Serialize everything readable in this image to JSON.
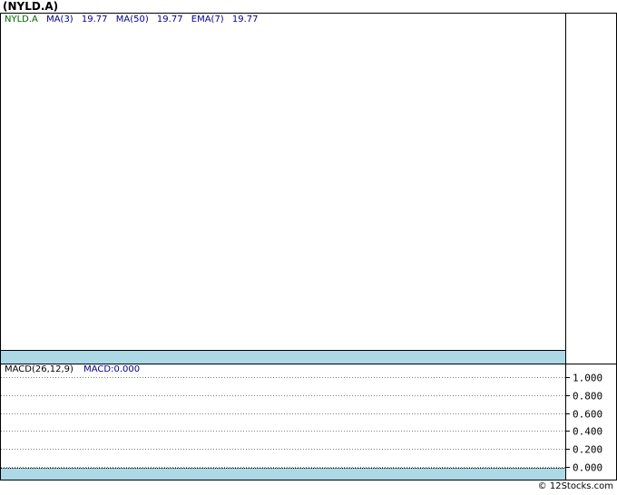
{
  "title": "(NYLD.A)",
  "legend": {
    "symbol": "NYLD.A",
    "ma3_label": "MA(3)",
    "ma3_value": "19.77",
    "ma50_label": "MA(50)",
    "ma50_value": "19.77",
    "ema7_label": "EMA(7)",
    "ema7_value": "19.77"
  },
  "macd_legend": {
    "label": "MACD(26,12,9)",
    "value": "MACD:0.000"
  },
  "footer": "© 12Stocks.com",
  "chart_data": {
    "type": "line",
    "title": "(NYLD.A)",
    "panels": [
      {
        "name": "price",
        "series": [
          {
            "name": "MA(3)",
            "last_value": 19.77
          },
          {
            "name": "MA(50)",
            "last_value": 19.77
          },
          {
            "name": "EMA(7)",
            "last_value": 19.77
          }
        ]
      },
      {
        "name": "MACD(26,12,9)",
        "series": [
          {
            "name": "MACD",
            "last_value": 0.0
          }
        ],
        "ylim": [
          0,
          1
        ],
        "yticks": [
          "1.000",
          "0.800",
          "0.600",
          "0.400",
          "0.200",
          "0.000"
        ],
        "ytick_values": [
          1.0,
          0.8,
          0.6,
          0.4,
          0.2,
          0.0
        ],
        "grid": true
      }
    ]
  },
  "colors": {
    "band": "#add8e6",
    "symbol": "#006400",
    "indicator": "#00008b"
  }
}
